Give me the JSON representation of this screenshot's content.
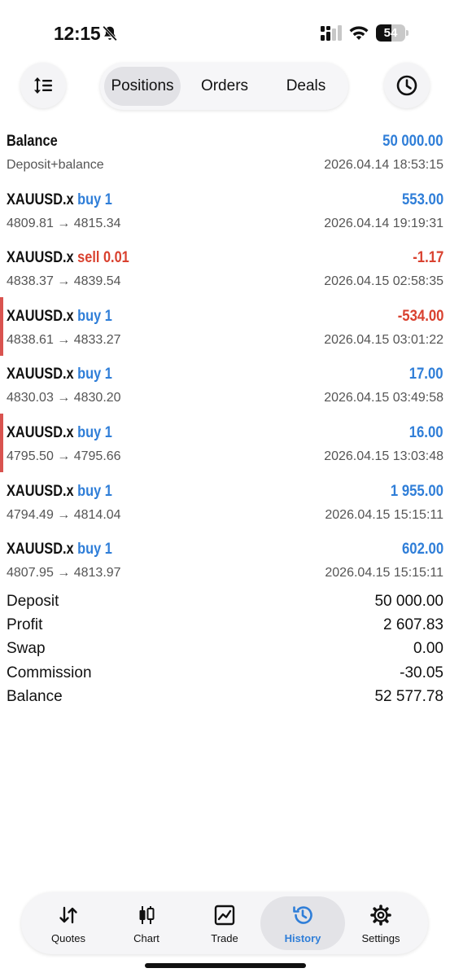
{
  "status_bar": {
    "time": "12:15",
    "battery": "54",
    "battery_level": 0.54
  },
  "toolbar": {
    "tabs": [
      "Positions",
      "Orders",
      "Deals"
    ],
    "selected": "Positions"
  },
  "rows": [
    {
      "symbol": "Balance",
      "side": "",
      "amount": "50 000.00",
      "sub": "Deposit+balance",
      "timestamp": "2026.04.14 18:53:15",
      "amount_color": "#2f7ed8",
      "flag": false
    },
    {
      "symbol": "XAUUSD.x",
      "side": "buy 1",
      "amount": "553.00",
      "sub": "4809.81 → 4815.34",
      "timestamp": "2026.04.14 19:19:31",
      "amount_color": "#2f7ed8",
      "flag": false
    },
    {
      "symbol": "XAUUSD.x",
      "side": "sell 0.01",
      "amount": "-1.17",
      "sub": "4838.37 → 4839.54",
      "timestamp": "2026.04.15 02:58:35",
      "amount_color": "#d9412f",
      "flag": false
    },
    {
      "symbol": "XAUUSD.x",
      "side": "buy 1",
      "amount": "-534.00",
      "sub": "4838.61 → 4833.27",
      "timestamp": "2026.04.15 03:01:22",
      "amount_color": "#d9412f",
      "flag": true
    },
    {
      "symbol": "XAUUSD.x",
      "side": "buy 1",
      "amount": "17.00",
      "sub": "4830.03 → 4830.20",
      "timestamp": "2026.04.15 03:49:58",
      "amount_color": "#2f7ed8",
      "flag": false
    },
    {
      "symbol": "XAUUSD.x",
      "side": "buy 1",
      "amount": "16.00",
      "sub": "4795.50 → 4795.66",
      "timestamp": "2026.04.15 13:03:48",
      "amount_color": "#2f7ed8",
      "flag": true
    },
    {
      "symbol": "XAUUSD.x",
      "side": "buy 1",
      "amount": "1 955.00",
      "sub": "4794.49 → 4814.04",
      "timestamp": "2026.04.15 15:15:11",
      "amount_color": "#2f7ed8",
      "flag": false
    },
    {
      "symbol": "XAUUSD.x",
      "side": "buy 1",
      "amount": "602.00",
      "sub": "4807.95 → 4813.97",
      "timestamp": "2026.04.15 15:15:11",
      "amount_color": "#2f7ed8",
      "flag": false
    }
  ],
  "summary": [
    {
      "label": "Deposit",
      "value": "50 000.00"
    },
    {
      "label": "Profit",
      "value": "2 607.83"
    },
    {
      "label": "Swap",
      "value": "0.00"
    },
    {
      "label": "Commission",
      "value": "-30.05"
    },
    {
      "label": "Balance",
      "value": "52 577.78"
    }
  ],
  "tabbar": {
    "items": [
      {
        "label": "Quotes",
        "icon": "quotes-arrows-icon"
      },
      {
        "label": "Chart",
        "icon": "candlestick-icon"
      },
      {
        "label": "Trade",
        "icon": "trade-chart-icon"
      },
      {
        "label": "History",
        "icon": "history-clock-icon"
      },
      {
        "label": "Settings",
        "icon": "gear-icon"
      }
    ],
    "active": "History"
  },
  "colors": {
    "accent": "#2f7ed8",
    "loss": "#d9412f",
    "flag": "#d9534f"
  }
}
